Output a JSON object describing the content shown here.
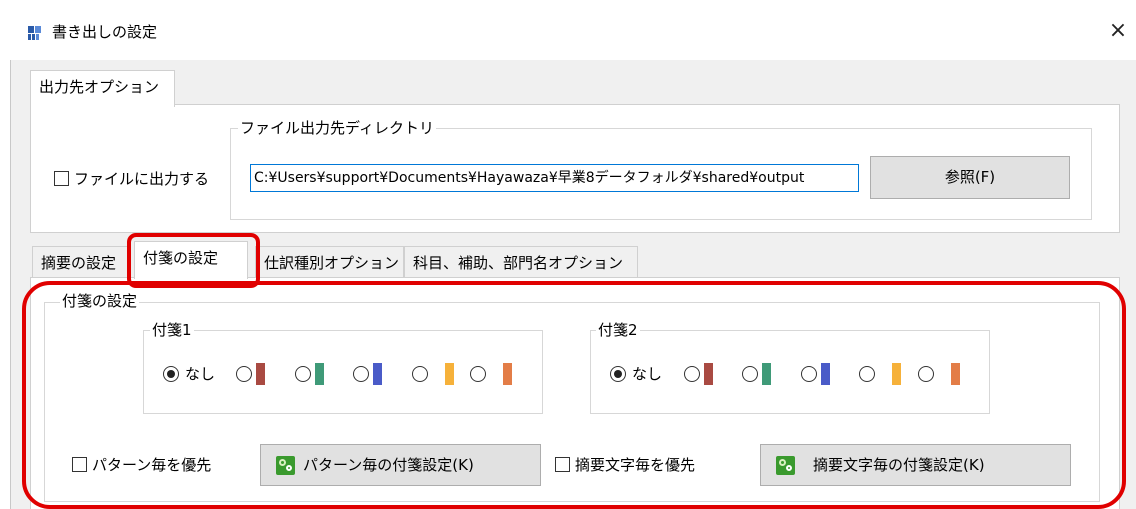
{
  "window": {
    "title": "書き出しの設定",
    "close_glyph": "×"
  },
  "output_tab": {
    "label": "出力先オプション"
  },
  "output": {
    "checkbox_label": "ファイルに出力する",
    "dir_group_label": "ファイル出力先ディレクトリ",
    "dir_value": "C:¥Users¥support¥Documents¥Hayawaza¥早業8データフォルダ¥shared¥output",
    "browse_label": "参照(F)"
  },
  "tabs": [
    {
      "label": "摘要の設定"
    },
    {
      "label": "付箋の設定"
    },
    {
      "label": "仕訳種別オプション"
    },
    {
      "label": "科目、補助、部門名オプション"
    }
  ],
  "fusen": {
    "group_label": "付箋の設定",
    "group1_label": "付箋1",
    "group2_label": "付箋2",
    "none_label": "なし",
    "swatch_colors": [
      "#a94a42",
      "#3f9a78",
      "#4a5bc8",
      "#f6b13a",
      "#e37d47"
    ],
    "selected_index": 0,
    "pattern_check_label": "パターン毎を優先",
    "pattern_button_label": "パターン毎の付箋設定(K)",
    "summary_check_label": "摘要文字毎を優先",
    "summary_button_label": "摘要文字毎の付箋設定(K)"
  },
  "highlight_color": "#e00000"
}
